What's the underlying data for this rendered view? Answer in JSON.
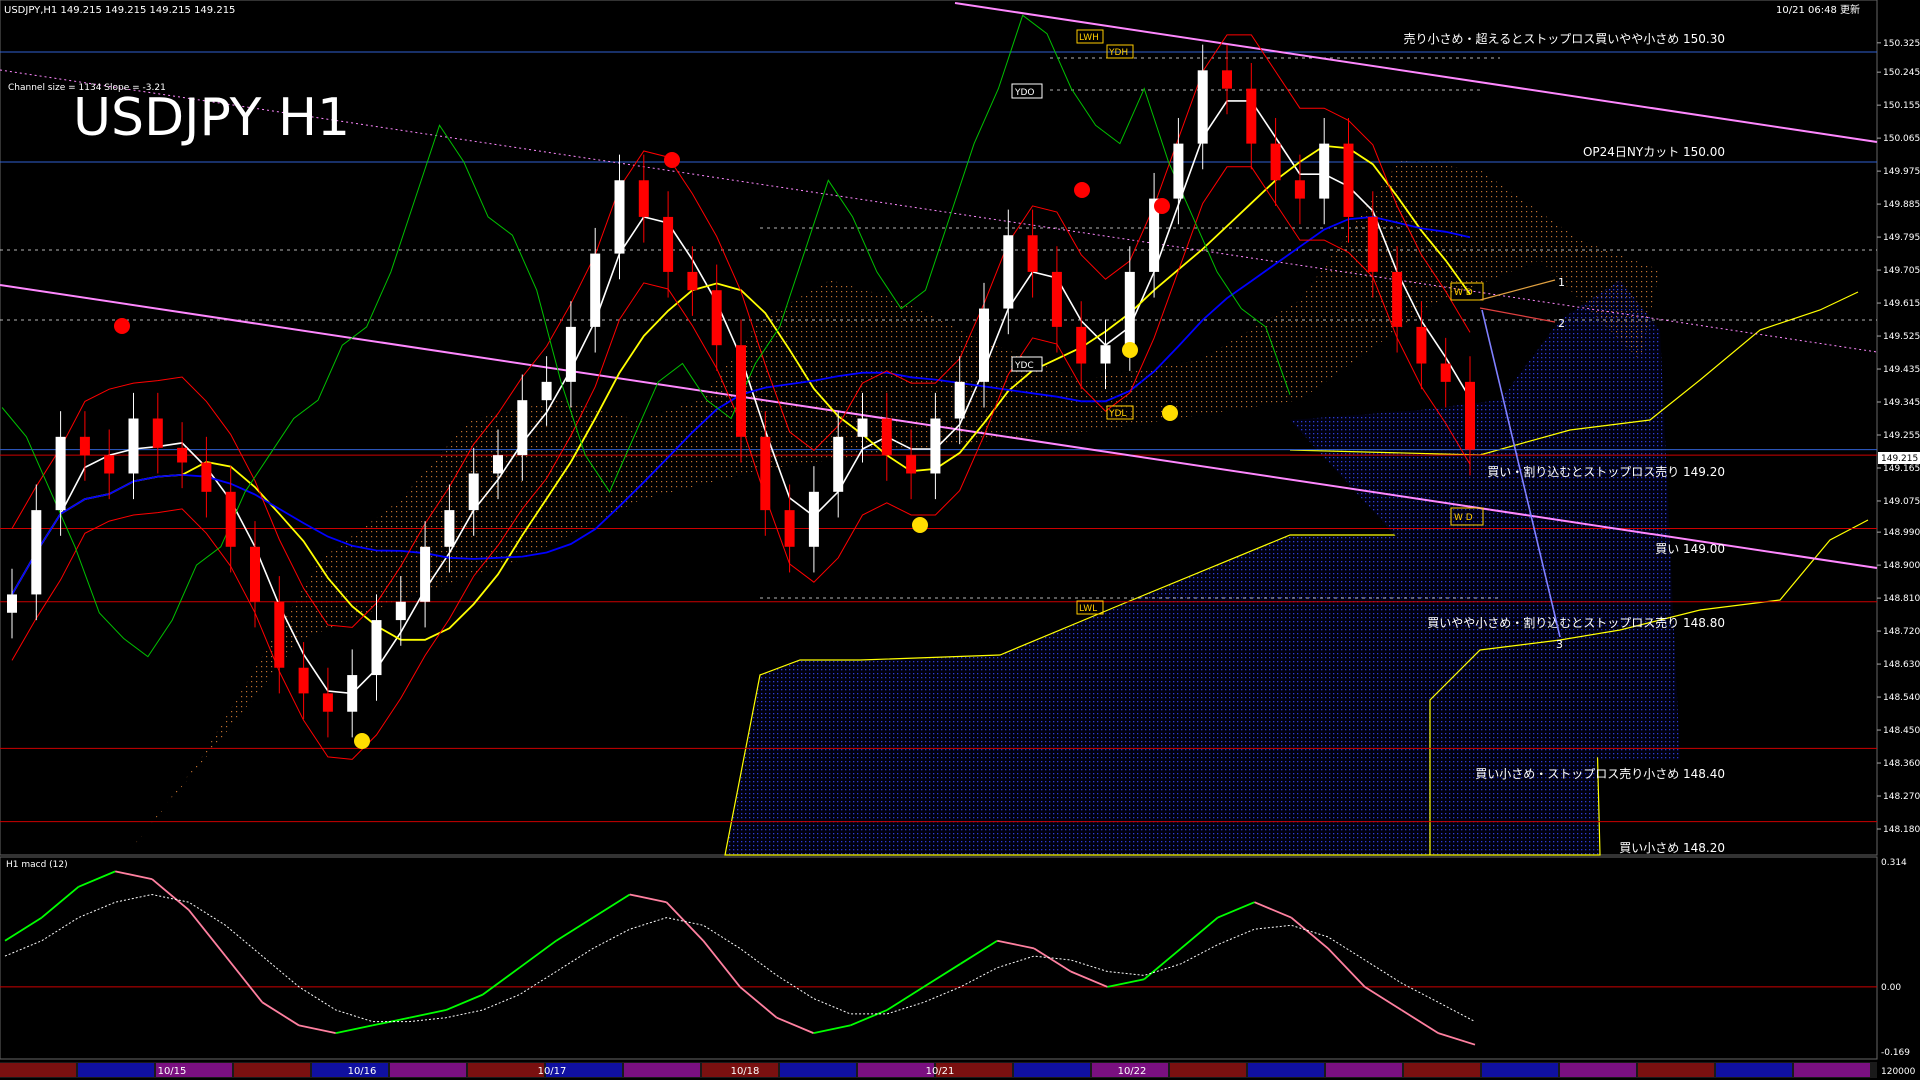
{
  "header": {
    "symbol_line": "USDJPY,H1  149.215 149.215 149.215 149.215",
    "timestamp": "10/21 06:48 更新",
    "channel_info": "Channel size = 1134 Slope = -3.21",
    "big_title": "USDJPY H1"
  },
  "colors": {
    "background": "#000000",
    "bull_candle": "#ffffff",
    "bear_candle": "#ff0000",
    "sma_short": "#ffffff",
    "sma_mid": "#ffff00",
    "sma_long": "#0000ff",
    "envelope": "#ff0000",
    "chikou": "#00c000",
    "kumo_bull": "#c07030",
    "kumo_bear": "#3030c0",
    "level_line": "#cc0000",
    "hline_blue": "#3060d0",
    "channel": "#ff88ff",
    "macd_up": "#00ff00",
    "macd_down": "#ff80a0",
    "macd_signal": "#ffffff"
  },
  "price_axis": {
    "ticks": [
      "150.325",
      "150.245",
      "150.155",
      "150.065",
      "149.975",
      "149.885",
      "149.795",
      "149.705",
      "149.615",
      "149.525",
      "149.435",
      "149.345",
      "149.255",
      "149.165",
      "149.075",
      "148.990",
      "148.900",
      "148.810",
      "148.720",
      "148.630",
      "148.540",
      "148.450",
      "148.360",
      "148.270",
      "148.180"
    ],
    "current": "149.215"
  },
  "macd_axis": {
    "title": "H1  macd (12)",
    "ticks": [
      "0.314",
      "0.00",
      "-0.169",
      "120000"
    ]
  },
  "date_axis": {
    "labels": [
      "10/15",
      "10/16",
      "10/17",
      "10/18",
      "10/21",
      "10/22"
    ]
  },
  "level_labels": [
    {
      "text": "売り小さめ・超えるとストップロス買いやや小さめ 150.30",
      "price": 150.3
    },
    {
      "text": "OP24日NYカット 150.00",
      "price": 150.0
    },
    {
      "text": "買い・割り込むとストップロス売り 149.20",
      "price": 149.2
    },
    {
      "text": "買い 149.00",
      "price": 149.0
    },
    {
      "text": "買いやや小さめ・割り込むとストップロス売り 148.80",
      "price": 148.8
    },
    {
      "text": "買い小さめ・ストップロス売り小さめ 148.40",
      "price": 148.4
    },
    {
      "text": "買い小さめ 148.20",
      "price": 148.2
    }
  ],
  "marker_labels": {
    "lwh": "LWH",
    "ydh": "YDH",
    "ydo": "YDO",
    "ydc": "YDC",
    "ydl": "YDL",
    "lwl": "LWL",
    "wd_top": "W D",
    "wd_bottom": "W D",
    "proj_1": "1",
    "proj_2": "2",
    "proj_3": "3"
  },
  "chart_data": {
    "type": "candlestick",
    "title": "USDJPY H1",
    "x_dates": [
      "10/15",
      "10/16",
      "10/17",
      "10/18",
      "10/21",
      "10/22"
    ],
    "ylim": [
      148.15,
      150.36
    ],
    "current_price": 149.215,
    "horizontal_levels": [
      150.3,
      150.0,
      149.2,
      149.0,
      148.8,
      148.4,
      148.2
    ],
    "candles_close_approx": [
      148.82,
      149.05,
      149.25,
      149.2,
      149.15,
      149.3,
      149.22,
      149.18,
      149.1,
      148.95,
      148.8,
      148.62,
      148.55,
      148.5,
      148.6,
      148.75,
      148.8,
      148.95,
      149.05,
      149.15,
      149.2,
      149.35,
      149.4,
      149.55,
      149.75,
      149.95,
      149.85,
      149.7,
      149.65,
      149.5,
      149.25,
      149.05,
      148.95,
      149.1,
      149.25,
      149.3,
      149.2,
      149.15,
      149.3,
      149.4,
      149.6,
      149.8,
      149.7,
      149.55,
      149.45,
      149.5,
      149.7,
      149.9,
      150.05,
      150.25,
      150.2,
      150.05,
      149.95,
      149.9,
      150.05,
      149.85,
      149.7,
      149.55,
      149.45,
      149.4,
      149.215
    ],
    "macd": {
      "range": [
        -0.169,
        0.314
      ],
      "main": [
        0.12,
        0.18,
        0.26,
        0.3,
        0.28,
        0.2,
        0.08,
        -0.04,
        -0.1,
        -0.12,
        -0.1,
        -0.08,
        -0.06,
        -0.02,
        0.05,
        0.12,
        0.18,
        0.24,
        0.22,
        0.12,
        0.0,
        -0.08,
        -0.12,
        -0.1,
        -0.06,
        0.0,
        0.06,
        0.12,
        0.1,
        0.04,
        0.0,
        0.02,
        0.1,
        0.18,
        0.22,
        0.18,
        0.1,
        0.0,
        -0.06,
        -0.12,
        -0.15
      ],
      "signal": [
        0.08,
        0.12,
        0.18,
        0.22,
        0.24,
        0.22,
        0.16,
        0.08,
        0.0,
        -0.06,
        -0.09,
        -0.09,
        -0.08,
        -0.06,
        -0.02,
        0.04,
        0.1,
        0.15,
        0.18,
        0.16,
        0.1,
        0.03,
        -0.03,
        -0.07,
        -0.07,
        -0.04,
        0.0,
        0.05,
        0.08,
        0.07,
        0.04,
        0.03,
        0.06,
        0.11,
        0.15,
        0.16,
        0.13,
        0.07,
        0.01,
        -0.04,
        -0.09
      ]
    }
  }
}
